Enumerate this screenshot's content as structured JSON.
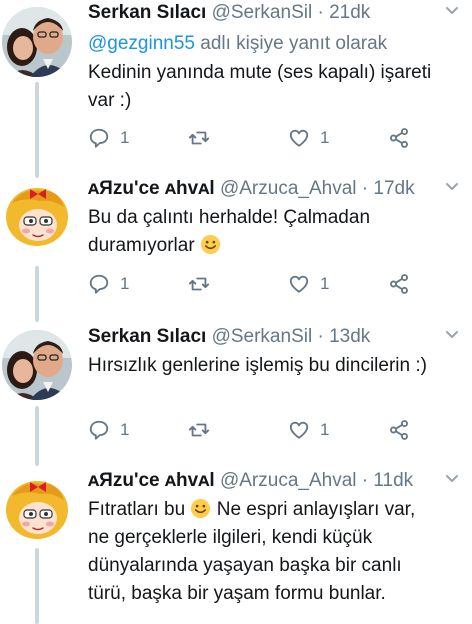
{
  "tweets": [
    {
      "author": "Serkan Sılacı",
      "handle": "@SerkanSil",
      "separator": "·",
      "time": "21dk",
      "reply_prefix": "@gezginn55",
      "reply_suffix": " adlı kişiye yanıt olarak",
      "text_lines": [
        "Kedinin yanında mute (ses kapalı) işareti",
        "var :)"
      ],
      "reply_count": "1",
      "like_count": "1",
      "avatar": "couple-photo"
    },
    {
      "author": "ᴀЯzu'ce ᴀhvᴀl",
      "handle": "@Arzuca_Ahval",
      "separator": "·",
      "time": "17dk",
      "text_lines": [
        "Bu da çalıntı herhalde! Çalmadan",
        "duramıyorlar"
      ],
      "reply_count": "1",
      "like_count": "1",
      "avatar": "cartoon-girl"
    },
    {
      "author": "Serkan Sılacı",
      "handle": "@SerkanSil",
      "separator": "·",
      "time": "13dk",
      "text_lines": [
        "Hırsızlık genlerine işlemiş bu dincilerin :)"
      ],
      "reply_count": "1",
      "like_count": "1",
      "avatar": "couple-photo"
    },
    {
      "author": "ᴀЯzu'ce ᴀhvᴀl",
      "handle": "@Arzuca_Ahval",
      "separator": "·",
      "time": "11dk",
      "text_lines": [
        "Fıtratları bu",
        "Ne espri anlayışları var,",
        "ne gerçeklerle ilgileri, kendi küçük",
        "dünyalarında yaşayan başka bir canlı",
        "türü, başka bir yaşam formu bunlar."
      ],
      "avatar": "cartoon-girl"
    }
  ],
  "colors": {
    "name": "#14171a",
    "meta": "#657786",
    "link": "#1b95e0",
    "thread_line": "#ccd6dd"
  },
  "icons": [
    "reply-icon",
    "retweet-icon",
    "like-icon",
    "share-icon",
    "chevron-down-icon",
    "smiling-emoji"
  ]
}
